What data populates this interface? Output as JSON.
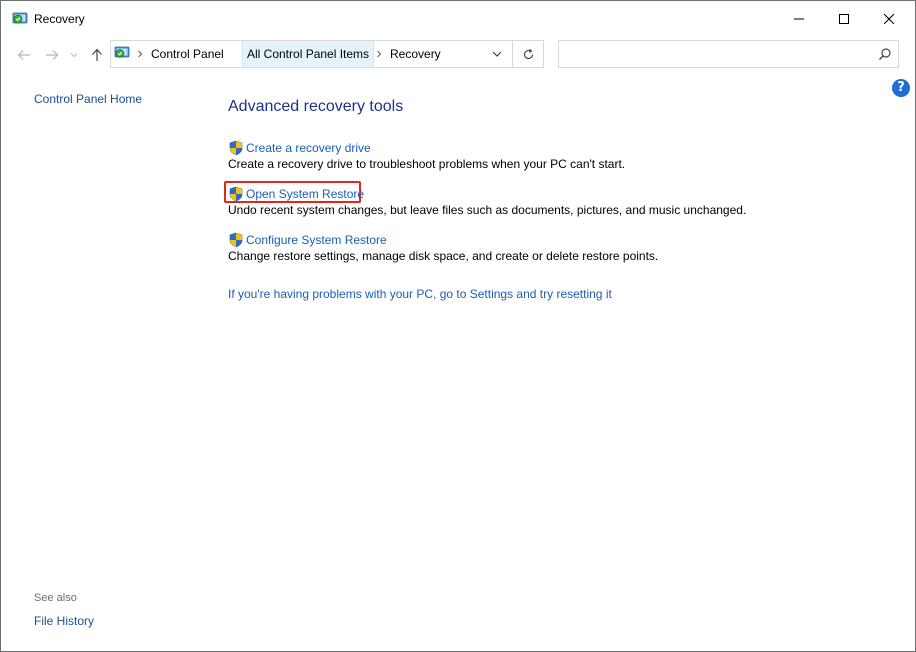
{
  "window": {
    "title": "Recovery"
  },
  "address": {
    "crumbs": [
      "Control Panel",
      "All Control Panel Items",
      "Recovery"
    ]
  },
  "search": {
    "placeholder": ""
  },
  "help": {
    "label": "?"
  },
  "sidebar": {
    "home_label": "Control Panel Home",
    "see_also_label": "See also",
    "see_also_items": [
      "File History"
    ]
  },
  "main": {
    "heading": "Advanced recovery tools",
    "tasks": [
      {
        "label": "Create a recovery drive",
        "description": "Create a recovery drive to troubleshoot problems when your PC can't start."
      },
      {
        "label": "Open System Restore",
        "description": "Undo recent system changes, but leave files such as documents, pictures, and music unchanged."
      },
      {
        "label": "Configure System Restore",
        "description": "Change restore settings, manage disk space, and create or delete restore points."
      }
    ],
    "reset_link": "If you're having problems with your PC, go to Settings and try resetting it"
  },
  "colors": {
    "link": "#1a5eb5",
    "heading": "#1e3287",
    "highlight": "#e2261f",
    "crumb_highlight": "#e5f3fb"
  }
}
